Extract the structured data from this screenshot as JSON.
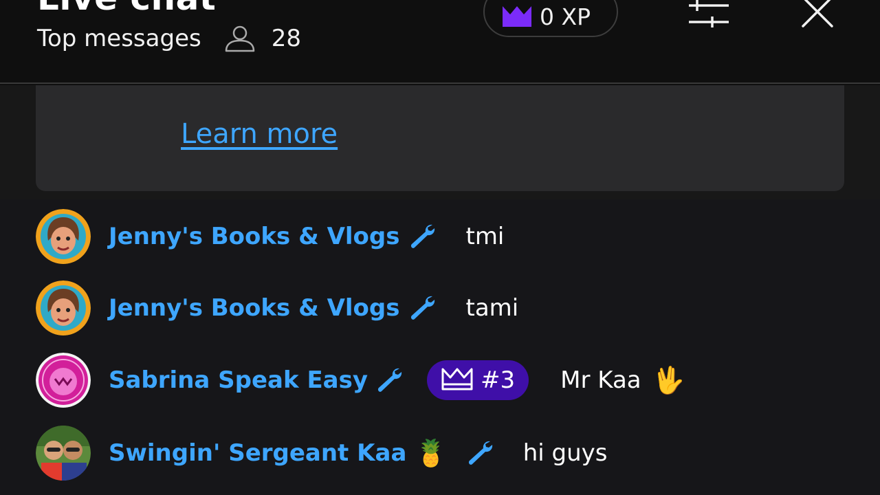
{
  "header": {
    "title": "Live chat",
    "mode_label": "Top messages",
    "viewer_count": "28",
    "xp_label": "0 XP",
    "icons": [
      "person-icon",
      "crown-icon",
      "sliders-icon",
      "close-icon"
    ]
  },
  "banner": {
    "link_label": "Learn more"
  },
  "colors": {
    "background": "#0f0f0f",
    "chat_background": "#161619",
    "banner": "#2a2a2c",
    "author": "#3ea6ff",
    "crown_purple": "#7b2bf9",
    "rank_pill": "#3f0fa8"
  },
  "messages": [
    {
      "author": "Jenny's Books & Vlogs",
      "badges": [
        "wrench-icon"
      ],
      "text": "tmi"
    },
    {
      "author": "Jenny's Books & Vlogs",
      "badges": [
        "wrench-icon"
      ],
      "text": "tami"
    },
    {
      "author": "Sabrina Speak Easy",
      "badges": [
        "wrench-icon"
      ],
      "rank": "#3",
      "text": "Mr Kaa",
      "emoji": "🖖"
    },
    {
      "author": "Swingin' Sergeant Kaa",
      "author_emoji": "🍍",
      "badges": [
        "wrench-icon"
      ],
      "text": "hi guys"
    }
  ]
}
